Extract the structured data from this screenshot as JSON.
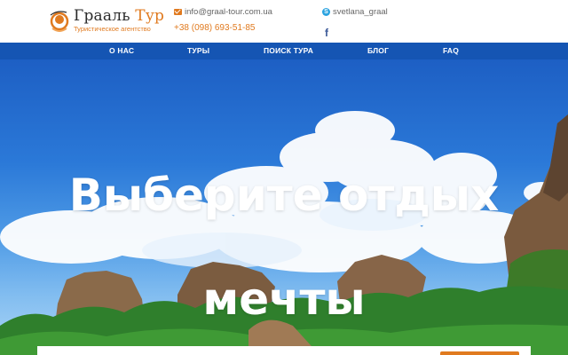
{
  "brand": {
    "name_main": "Грааль",
    "name_accent": "Тур",
    "tagline": "Туристическое агентство",
    "accent_color": "#e07a1f"
  },
  "contacts": {
    "email": "info@graal-tour.com.ua",
    "phone": "+38 (098) 693-51-85",
    "skype": "svetlana_graal",
    "email_icon": "envelope-icon",
    "skype_icon": "skype-icon",
    "facebook_icon": "facebook-icon"
  },
  "nav": {
    "background": "#1555b3",
    "items": [
      "О НАС",
      "ТУРЫ",
      "ПОИСК ТУРА",
      "БЛОГ",
      "FAQ"
    ]
  },
  "hero": {
    "headline_line1": "Выберите отдых",
    "headline_line2": "мечты"
  }
}
